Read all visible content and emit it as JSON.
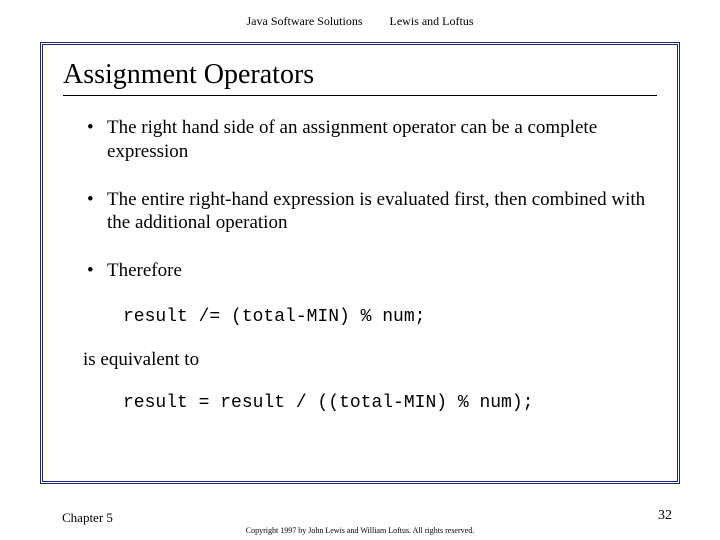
{
  "header": {
    "book": "Java Software Solutions",
    "authors": "Lewis and Loftus"
  },
  "title": "Assignment Operators",
  "bullets": {
    "b1": "The right hand side of an assignment operator can be a complete expression",
    "b2": "The entire right-hand expression is evaluated first, then combined with the additional operation",
    "b3": "Therefore"
  },
  "code": {
    "c1": "result /= (total-MIN) % num;",
    "c2": "result = result / ((total-MIN) % num);"
  },
  "plain": {
    "equiv": "is equivalent to"
  },
  "footer": {
    "chapter": "Chapter 5",
    "copyright": "Copyright 1997 by John Lewis and William Loftus. All rights reserved.",
    "page": "32"
  }
}
